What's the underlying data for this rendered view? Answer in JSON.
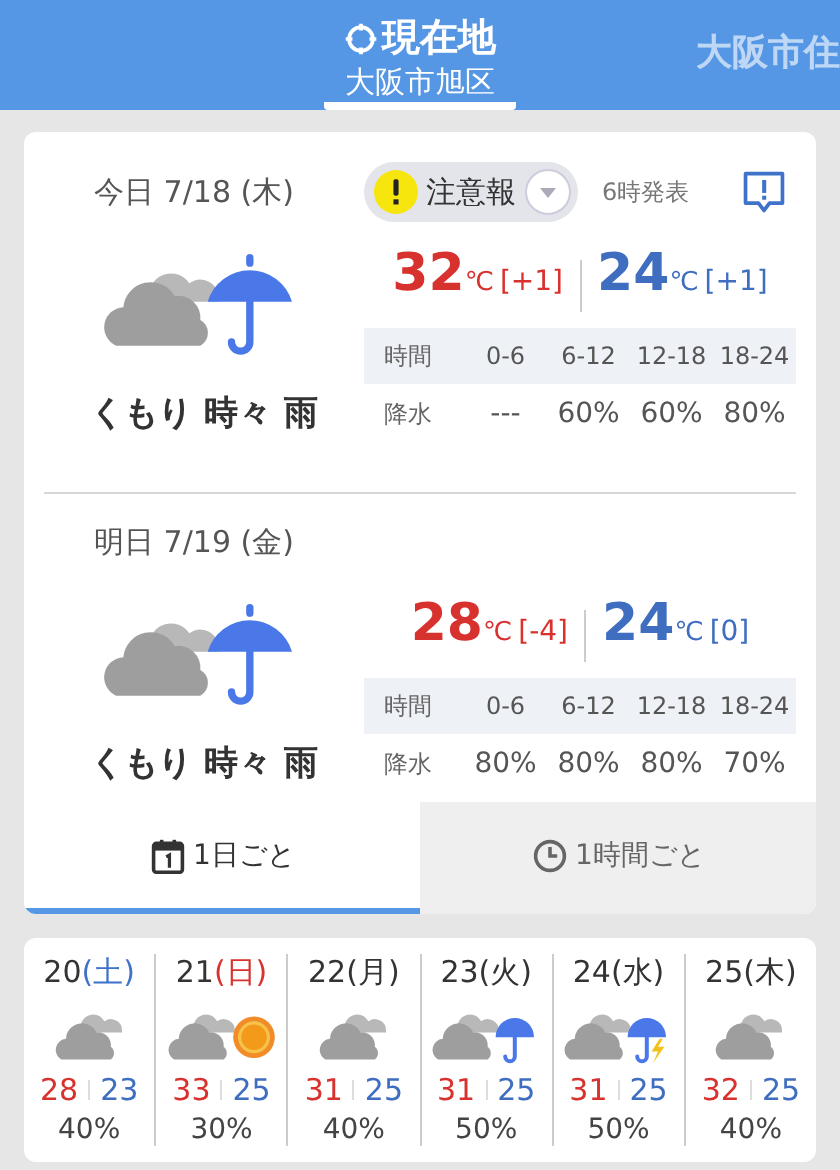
{
  "header": {
    "locations": [
      {
        "label": "現在地",
        "sublabel": "大阪市旭区",
        "selected": true,
        "kind": "current"
      },
      {
        "label": "大阪市住",
        "selected": false,
        "kind": "city"
      }
    ]
  },
  "alert": {
    "label": "注意報",
    "issued": "6時発表"
  },
  "days": [
    {
      "date": "今日 7/18 (木)",
      "condition": "くもり 時々 雨",
      "kind": "cloudy_rain",
      "high": "32",
      "high_diff": "[+1]",
      "low": "24",
      "low_diff": "[+1]",
      "unit": "℃",
      "table": {
        "header": [
          "時間",
          "0-6",
          "6-12",
          "12-18",
          "18-24"
        ],
        "rain": [
          "降水",
          "---",
          "60%",
          "60%",
          "80%"
        ]
      }
    },
    {
      "date": "明日 7/19 (金)",
      "condition": "くもり 時々 雨",
      "kind": "cloudy_rain",
      "high": "28",
      "high_diff": "[-4]",
      "low": "24",
      "low_diff": "[0]",
      "unit": "℃",
      "table": {
        "header": [
          "時間",
          "0-6",
          "6-12",
          "12-18",
          "18-24"
        ],
        "rain": [
          "降水",
          "80%",
          "80%",
          "80%",
          "70%"
        ]
      }
    }
  ],
  "tabs": [
    {
      "label": "1日ごと",
      "kind": "daily",
      "selected": true
    },
    {
      "label": "1時間ごと",
      "kind": "hourly",
      "selected": false
    }
  ],
  "week": [
    {
      "day": "20",
      "weekday": "(土)",
      "color": "#3f72c9",
      "kind": "cloudy",
      "high": "28",
      "low": "23",
      "rain": "40%"
    },
    {
      "day": "21",
      "weekday": "(日)",
      "color": "#d8322f",
      "kind": "cloudy_sun",
      "high": "33",
      "low": "25",
      "rain": "30%"
    },
    {
      "day": "22",
      "weekday": "(月)",
      "color": "#333333",
      "kind": "cloudy",
      "high": "31",
      "low": "25",
      "rain": "40%"
    },
    {
      "day": "23",
      "weekday": "(火)",
      "color": "#333333",
      "kind": "cloudy_rain",
      "high": "31",
      "low": "25",
      "rain": "50%"
    },
    {
      "day": "24",
      "weekday": "(水)",
      "color": "#333333",
      "kind": "cloudy_rain_thunder",
      "high": "31",
      "low": "25",
      "rain": "50%"
    },
    {
      "day": "25",
      "weekday": "(木)",
      "color": "#333333",
      "kind": "cloudy",
      "high": "32",
      "low": "25",
      "rain": "40%"
    }
  ]
}
